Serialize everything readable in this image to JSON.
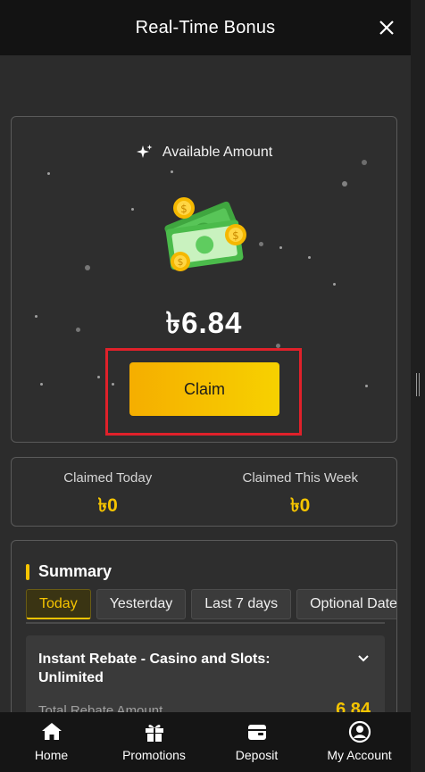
{
  "header": {
    "title": "Real-Time Bonus",
    "close_icon": "close-icon"
  },
  "bonus": {
    "available_label": "Available Amount",
    "sparkle_icon": "sparkle-icon",
    "amount": "৳6.84",
    "claim_label": "Claim"
  },
  "claimed": {
    "today_label": "Claimed Today",
    "today_value": "৳0",
    "week_label": "Claimed This Week",
    "week_value": "৳0"
  },
  "summary": {
    "title": "Summary",
    "tabs": [
      {
        "label": "Today",
        "active": true
      },
      {
        "label": "Yesterday",
        "active": false
      },
      {
        "label": "Last 7 days",
        "active": false
      },
      {
        "label": "Optional Date",
        "active": false
      }
    ],
    "rebate": {
      "title": "Instant Rebate - Casino and Slots: Unlimited",
      "total_label": "Total Rebate Amount",
      "total_value": "6.84"
    }
  },
  "nav": {
    "items": [
      {
        "label": "Home",
        "icon": "home-icon"
      },
      {
        "label": "Promotions",
        "icon": "gift-icon"
      },
      {
        "label": "Deposit",
        "icon": "wallet-icon"
      },
      {
        "label": "My Account",
        "icon": "account-icon"
      }
    ]
  },
  "colors": {
    "accent": "#f5c400",
    "highlight": "#e0212a",
    "background": "#2c2c2c"
  }
}
